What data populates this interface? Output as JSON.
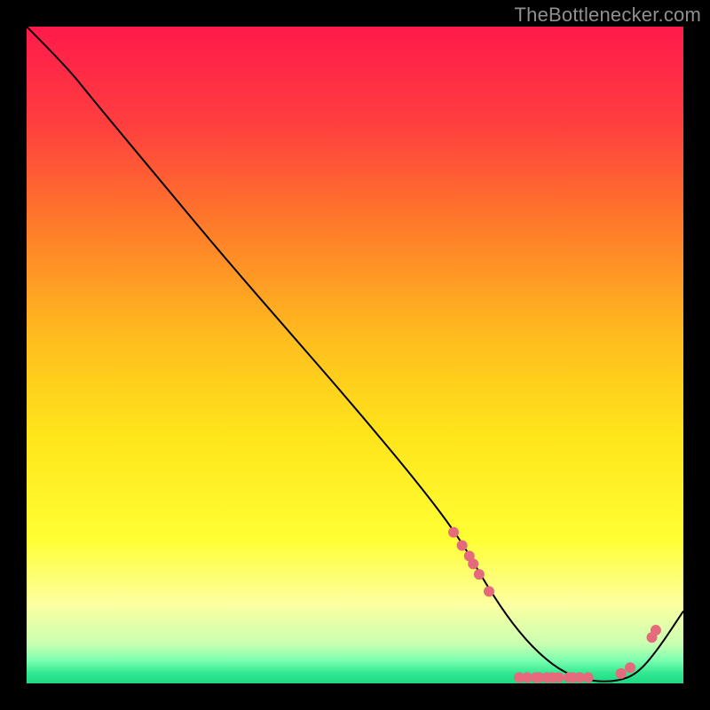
{
  "attribution": "TheBottlenecker.com",
  "chart_data": {
    "type": "line",
    "title": "",
    "xlabel": "",
    "ylabel": "",
    "xlim": [
      0,
      100
    ],
    "ylim": [
      0,
      100
    ],
    "background_gradient": [
      {
        "stop": 0.0,
        "color": "#ff1a4b"
      },
      {
        "stop": 0.15,
        "color": "#ff3f3f"
      },
      {
        "stop": 0.3,
        "color": "#ff7a2a"
      },
      {
        "stop": 0.48,
        "color": "#ffbf1e"
      },
      {
        "stop": 0.62,
        "color": "#ffe41a"
      },
      {
        "stop": 0.78,
        "color": "#ffff33"
      },
      {
        "stop": 0.88,
        "color": "#fdffa1"
      },
      {
        "stop": 0.94,
        "color": "#caffb1"
      },
      {
        "stop": 0.965,
        "color": "#7cffb0"
      },
      {
        "stop": 0.985,
        "color": "#2fe88f"
      },
      {
        "stop": 1.0,
        "color": "#1fd983"
      }
    ],
    "series": [
      {
        "name": "curve",
        "color": "#000000",
        "x": [
          0,
          6,
          10,
          20,
          30,
          40,
          50,
          60,
          66,
          70,
          74,
          78,
          82,
          86,
          90,
          93,
          96,
          100
        ],
        "y": [
          100,
          94,
          89,
          77,
          65,
          53.5,
          42,
          30,
          22,
          15,
          9,
          4.5,
          1.5,
          0.3,
          0.3,
          1.5,
          5,
          11
        ]
      }
    ],
    "marker_clusters": [
      {
        "name": "left-cluster",
        "color": "#e46a7c",
        "radius": 6,
        "points": [
          {
            "x": 65.0,
            "y": 23.0
          },
          {
            "x": 66.3,
            "y": 21.0
          },
          {
            "x": 67.4,
            "y": 19.4
          },
          {
            "x": 68.0,
            "y": 18.2
          },
          {
            "x": 68.9,
            "y": 16.6
          },
          {
            "x": 70.4,
            "y": 14.0
          }
        ]
      },
      {
        "name": "bottom-cluster",
        "color": "#e46a7c",
        "radius": 6,
        "points": [
          {
            "x": 75.0,
            "y": 0.9
          },
          {
            "x": 76.2,
            "y": 0.9
          },
          {
            "x": 77.5,
            "y": 0.9
          },
          {
            "x": 78.0,
            "y": 0.9
          },
          {
            "x": 79.2,
            "y": 0.9
          },
          {
            "x": 80.0,
            "y": 0.9
          },
          {
            "x": 81.0,
            "y": 0.9
          },
          {
            "x": 82.6,
            "y": 0.9
          },
          {
            "x": 83.1,
            "y": 0.9
          },
          {
            "x": 84.2,
            "y": 0.9
          },
          {
            "x": 85.5,
            "y": 0.9
          }
        ]
      },
      {
        "name": "right-cluster",
        "color": "#e46a7c",
        "radius": 6,
        "points": [
          {
            "x": 90.5,
            "y": 1.5
          },
          {
            "x": 91.9,
            "y": 2.4
          },
          {
            "x": 95.2,
            "y": 7.0
          },
          {
            "x": 95.8,
            "y": 8.1
          }
        ]
      }
    ]
  }
}
